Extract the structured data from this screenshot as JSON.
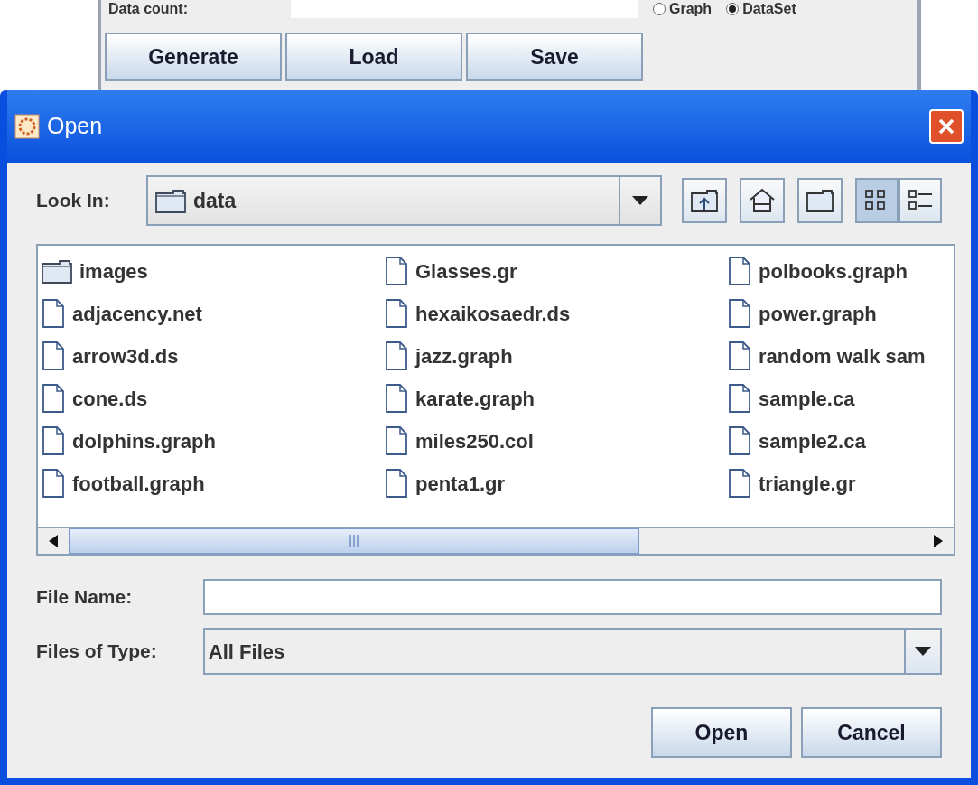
{
  "background_window": {
    "data_count_label": "Data count:",
    "radios": [
      {
        "label": "Graph",
        "selected": false
      },
      {
        "label": "DataSet",
        "selected": true
      }
    ],
    "buttons": [
      "Generate",
      "Load",
      "Save"
    ]
  },
  "dialog": {
    "title": "Open",
    "look_in": {
      "label": "Look In:",
      "value": "data"
    },
    "files": [
      {
        "name": "images",
        "kind": "folder"
      },
      {
        "name": "adjacency.net",
        "kind": "file"
      },
      {
        "name": "arrow3d.ds",
        "kind": "file"
      },
      {
        "name": "cone.ds",
        "kind": "file"
      },
      {
        "name": "dolphins.graph",
        "kind": "file"
      },
      {
        "name": "football.graph",
        "kind": "file"
      },
      {
        "name": "Glasses.gr",
        "kind": "file"
      },
      {
        "name": "hexaikosaedr.ds",
        "kind": "file"
      },
      {
        "name": "jazz.graph",
        "kind": "file"
      },
      {
        "name": "karate.graph",
        "kind": "file"
      },
      {
        "name": "miles250.col",
        "kind": "file"
      },
      {
        "name": "penta1.gr",
        "kind": "file"
      },
      {
        "name": "polbooks.graph",
        "kind": "file"
      },
      {
        "name": "power.graph",
        "kind": "file"
      },
      {
        "name": "random walk sam",
        "kind": "file"
      },
      {
        "name": "sample.ca",
        "kind": "file"
      },
      {
        "name": "sample2.ca",
        "kind": "file"
      },
      {
        "name": "triangle.gr",
        "kind": "file"
      }
    ],
    "view_modes": [
      {
        "kind": "list",
        "selected": true
      },
      {
        "kind": "details",
        "selected": false
      }
    ],
    "file_name": {
      "label": "File Name:"
    },
    "files_of_type": {
      "label": "Files of Type:",
      "value": "All Files"
    },
    "buttons": [
      "Open",
      "Cancel"
    ]
  }
}
